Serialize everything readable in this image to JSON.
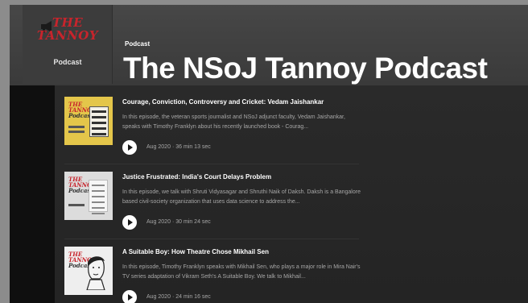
{
  "header": {
    "cover_logo_line1": "THE",
    "cover_logo_line2": "TANNOY",
    "cover_label": "Podcast",
    "kicker": "Podcast",
    "title": "The NSoJ Tannoy Podcast"
  },
  "thumbnail_logo": [
    "THE",
    "TANNOY",
    "Podcast"
  ],
  "episodes": [
    {
      "title": "Courage, Conviction, Controversy and Cricket: Vedam Jaishankar",
      "description": "In this episode, the veteran sports journalist and NSoJ adjunct faculty, Vedam Jaishankar, speaks with Timothy Franklyn about his recently launched book - Courag...",
      "date": "Aug 2020",
      "duration": "36 min 13 sec"
    },
    {
      "title": "Justice Frustrated: India's Court Delays Problem",
      "description": "In this episode, we talk with Shruti Vidyasagar and Shruthi Naik of Daksh. Daksh is a Bangalore based civil-society organization that uses data science to address the...",
      "date": "Aug 2020",
      "duration": "30 min 24 sec"
    },
    {
      "title": "A Suitable Boy: How Theatre Chose Mikhail Sen",
      "description": "In this episode, Timothy Franklyn speaks with Mikhail Sen, who plays a major role in Mira Nair's TV series adaptation of Vikram Seth's A Suitable Boy. We talk to Mikhail...",
      "date": "Aug 2020",
      "duration": "24 min 16 sec"
    }
  ],
  "colors": {
    "accent_red": "#c8242c",
    "background": "#181818",
    "header": "#474747"
  }
}
